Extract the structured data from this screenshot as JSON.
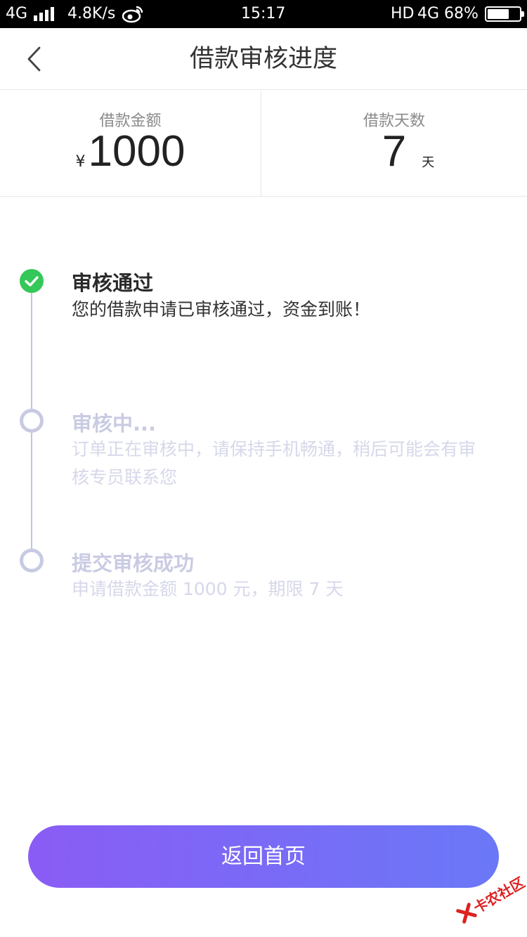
{
  "status_bar": {
    "network": "4G",
    "speed": "4.8K/s",
    "time": "15:17",
    "hd": "HD",
    "network_right": "4G",
    "battery_percent": "68%",
    "battery_level": 0.68
  },
  "nav": {
    "title": "借款审核进度"
  },
  "summary": {
    "amount_label": "借款金额",
    "currency_symbol": "¥",
    "amount_value": "1000",
    "days_label": "借款天数",
    "days_value": "7",
    "days_unit": "天"
  },
  "timeline": {
    "steps": [
      {
        "title": "审核通过",
        "desc": "您的借款申请已审核通过，资金到账！",
        "status": "done"
      },
      {
        "title": "审核中...",
        "desc": "订单正在审核中，请保持手机畅通，稍后可能会有审核专员联系您",
        "status": "pending"
      },
      {
        "title": "提交审核成功",
        "desc": "申请借款金额 1000 元，期限 7 天",
        "status": "pending"
      }
    ]
  },
  "actions": {
    "home_label": "返回首页"
  },
  "watermark": {
    "text": "卡农社区"
  },
  "colors": {
    "accent_start": "#8a5cf5",
    "accent_end": "#6a78f7",
    "success": "#34c759",
    "pending": "#c8cae3"
  }
}
